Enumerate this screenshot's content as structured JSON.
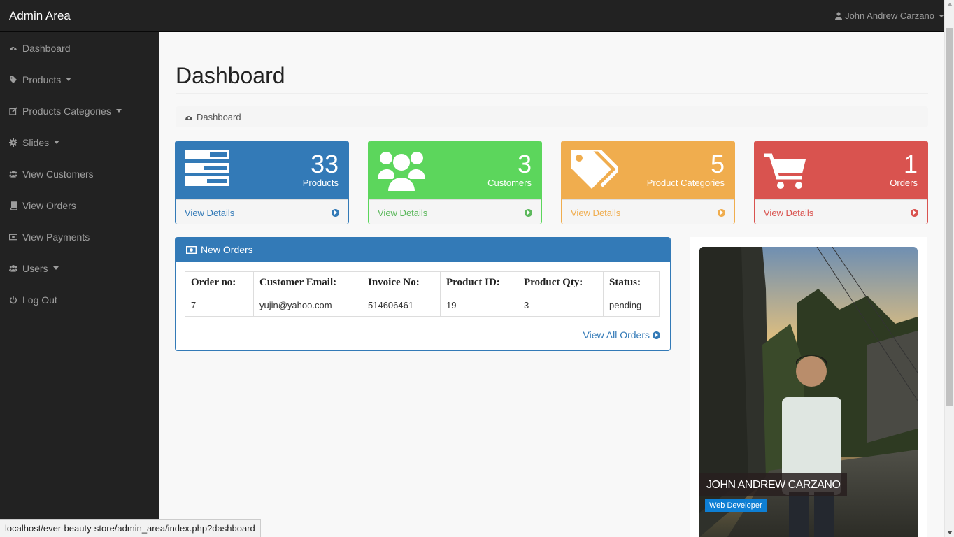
{
  "navbar": {
    "brand": "Admin Area",
    "user": "John Andrew Carzano"
  },
  "sidebar": {
    "items": [
      {
        "label": "Dashboard",
        "icon": "dashboard-icon"
      },
      {
        "label": "Products",
        "icon": "tag-icon"
      },
      {
        "label": "Products Categories",
        "icon": "edit-icon"
      },
      {
        "label": "Slides",
        "icon": "gear-icon"
      },
      {
        "label": "View Customers",
        "icon": "users-icon"
      },
      {
        "label": "View Orders",
        "icon": "book-icon"
      },
      {
        "label": "View Payments",
        "icon": "money-icon"
      },
      {
        "label": "Users",
        "icon": "users-icon"
      },
      {
        "label": "Log Out",
        "icon": "power-icon"
      }
    ]
  },
  "page": {
    "title": "Dashboard",
    "breadcrumb": "Dashboard"
  },
  "stats": [
    {
      "count": "33",
      "label": "Products",
      "link": "View Details",
      "color": "#337ab7"
    },
    {
      "count": "3",
      "label": "Customers",
      "link": "View Details",
      "color": "#5cd65c"
    },
    {
      "count": "5",
      "label": "Product Categories",
      "link": "View Details",
      "color": "#f0ad4e"
    },
    {
      "count": "1",
      "label": "Orders",
      "link": "View Details",
      "color": "#d9534f"
    }
  ],
  "orders": {
    "title": "New Orders",
    "columns": [
      "Order no:",
      "Customer Email:",
      "Invoice No:",
      "Product ID:",
      "Product Qty:",
      "Status:"
    ],
    "rows": [
      [
        "7",
        "yujin@yahoo.com",
        "514606461",
        "19",
        "3",
        "pending"
      ]
    ],
    "view_all": "View All Orders"
  },
  "profile": {
    "name": "JOHN ANDREW CARZANO",
    "role": "Web Developer"
  },
  "statusbar": {
    "url": "localhost/ever-beauty-store/admin_area/index.php?dashboard"
  }
}
